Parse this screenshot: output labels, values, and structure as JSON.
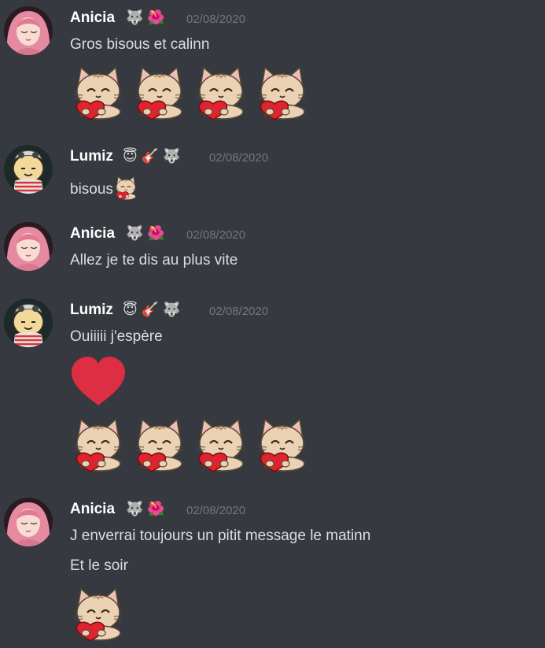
{
  "messages": [
    {
      "author": "Anicia",
      "badges": "🐺 🌺",
      "timestamp": "02/08/2020",
      "lines": [
        "Gros bisous et calinn"
      ]
    },
    {
      "author": "Lumiz",
      "badges": "😇 🎸 🐺",
      "timestamp": "02/08/2020",
      "lines": [
        "bisous"
      ]
    },
    {
      "author": "Anicia",
      "badges": "🐺 🌺",
      "timestamp": "02/08/2020",
      "lines": [
        "Allez je te dis au plus vite"
      ]
    },
    {
      "author": "Lumiz",
      "badges": "😇 🎸 🐺",
      "timestamp": "02/08/2020",
      "lines": [
        "Ouiiiii j'espère"
      ]
    },
    {
      "author": "Anicia",
      "badges": "🐺 🌺",
      "timestamp": "02/08/2020",
      "lines": [
        "J enverrai toujours un pitit message le matinn",
        "Et le soir"
      ]
    }
  ],
  "icons": {
    "cat_heart": "cat-heart-emoji",
    "heart": "red-heart-emoji"
  },
  "colors": {
    "background": "#36393f",
    "username": "#ffffff",
    "text": "#dcddde",
    "timestamp": "#72767d",
    "heart": "#dd2e44"
  }
}
